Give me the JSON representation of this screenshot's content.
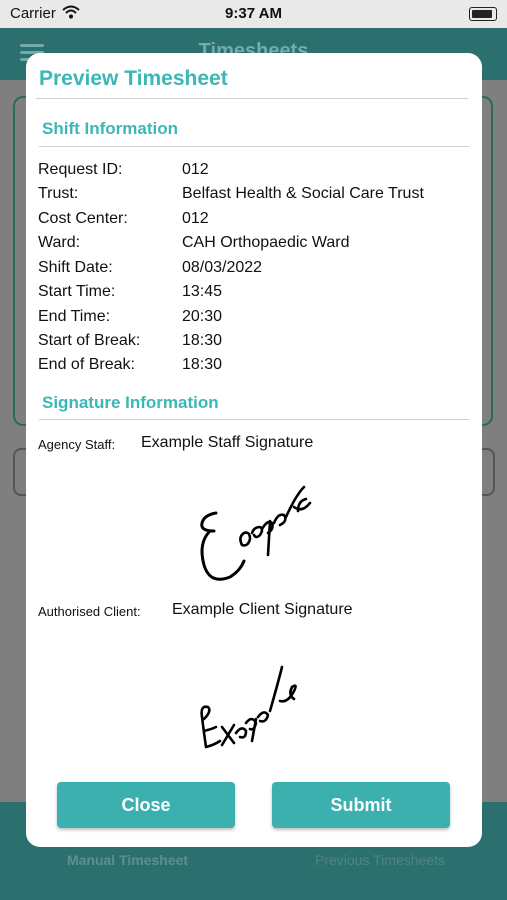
{
  "status_bar": {
    "carrier": "Carrier",
    "time": "9:37 AM"
  },
  "background": {
    "nav_title": "Timesheets",
    "tabs": [
      {
        "label": "Manual Timesheet"
      },
      {
        "label": "Previous Timesheets"
      }
    ]
  },
  "modal": {
    "title": "Preview Timesheet",
    "shift_section_title": "Shift Information",
    "shift_rows": [
      {
        "label": "Request ID:",
        "value": "012"
      },
      {
        "label": "Trust:",
        "value": "Belfast Health & Social Care Trust"
      },
      {
        "label": "Cost Center:",
        "value": "012"
      },
      {
        "label": "Ward:",
        "value": "CAH Orthopaedic Ward"
      },
      {
        "label": "Shift Date:",
        "value": "08/03/2022"
      },
      {
        "label": "Start Time:",
        "value": "13:45"
      },
      {
        "label": "End Time:",
        "value": "20:30"
      },
      {
        "label": "Start of Break:",
        "value": "18:30"
      },
      {
        "label": "End of Break:",
        "value": "18:30"
      }
    ],
    "signature_section_title": "Signature Information",
    "agency_staff": {
      "label": "Agency Staff:",
      "value": "Example Staff Signature",
      "signature_text": "Example"
    },
    "authorised_client": {
      "label": "Authorised Client:",
      "value": "Example Client Signature",
      "signature_text": "Example"
    },
    "buttons": {
      "close": "Close",
      "submit": "Submit"
    }
  },
  "colors": {
    "accent": "#3bb7b6",
    "button": "#3bb0ae",
    "navbar": "#2c6f6f"
  }
}
